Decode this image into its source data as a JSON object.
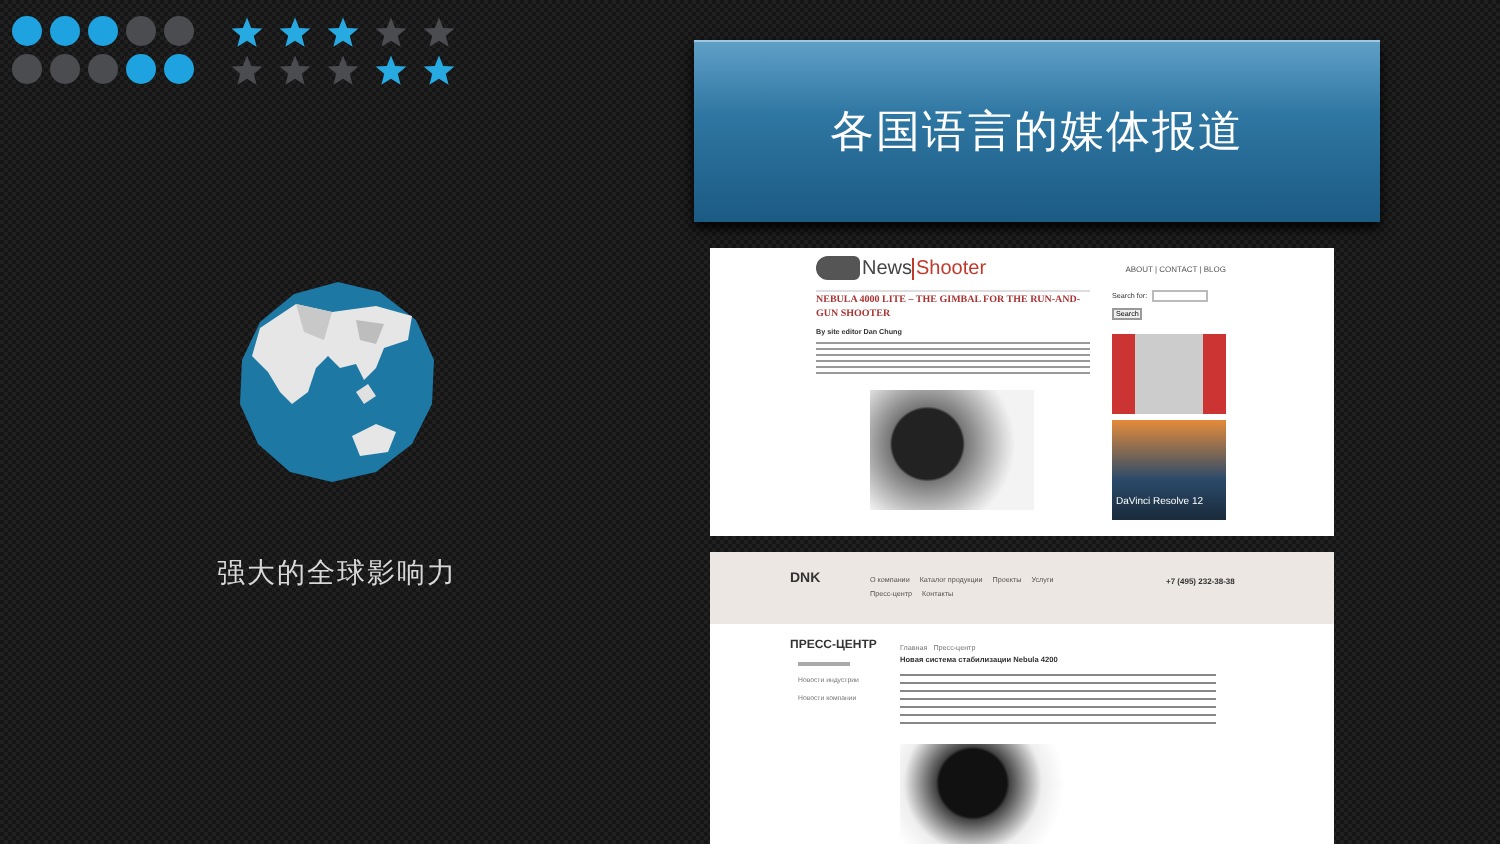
{
  "indicators": {
    "dot_rows": [
      [
        {
          "on": true
        },
        {
          "on": true
        },
        {
          "on": true
        },
        {
          "on": false
        },
        {
          "on": false
        }
      ],
      [
        {
          "on": false
        },
        {
          "on": false
        },
        {
          "on": false
        },
        {
          "on": true
        },
        {
          "on": true
        }
      ]
    ],
    "star_rows": [
      [
        {
          "on": true
        },
        {
          "on": true
        },
        {
          "on": true
        },
        {
          "on": false
        },
        {
          "on": false
        }
      ],
      [
        {
          "on": false
        },
        {
          "on": false
        },
        {
          "on": false
        },
        {
          "on": true
        },
        {
          "on": true
        }
      ]
    ]
  },
  "banner": {
    "title": "各国语言的媒体报道"
  },
  "globe": {
    "caption": "强大的全球影响力"
  },
  "articles": [
    {
      "kind": "newsshooter",
      "logo_left": "News",
      "logo_right": "Shooter",
      "nav": "ABOUT | CONTACT | BLOG",
      "headline": "NEBULA 4000 LITE – THE GIMBAL FOR THE RUN-AND-GUN SHOOTER",
      "byline": "By site editor Dan Chung",
      "search_label": "Search for:",
      "search_button": "Search",
      "ad_title": "DaVinci Resolve 12"
    },
    {
      "kind": "dnk",
      "logo": "DNK",
      "nav": [
        "О компании",
        "Каталог продукции",
        "Проекты",
        "Услуги",
        "Пресс-центр",
        "Контакты"
      ],
      "phone": "+7 (495) 232-38-38",
      "section": "ПРЕСС-ЦЕНТР",
      "side_links": [
        "Новости индустрии",
        "Новости компании"
      ],
      "breadcrumb": [
        "Главная",
        "Пресс-центр"
      ],
      "headline": "Новая система стабилизации Nebula 4200"
    }
  ]
}
